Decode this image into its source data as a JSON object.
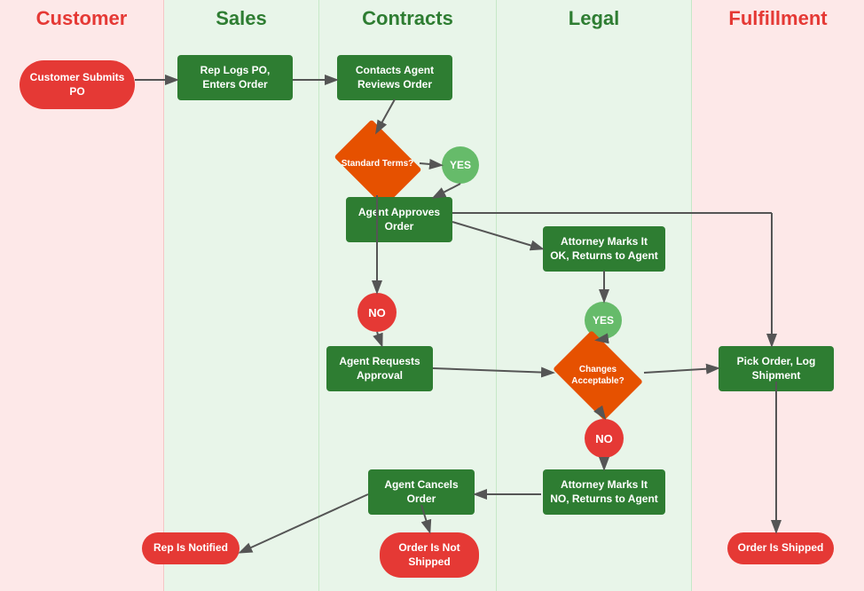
{
  "swimlanes": [
    {
      "id": "customer",
      "label": "Customer",
      "colorClass": "header-red",
      "bgClass": "swimlane-customer"
    },
    {
      "id": "sales",
      "label": "Sales",
      "colorClass": "header-green",
      "bgClass": "swimlane-sales"
    },
    {
      "id": "contracts",
      "label": "Contracts",
      "colorClass": "header-green",
      "bgClass": "swimlane-contracts"
    },
    {
      "id": "legal",
      "label": "Legal",
      "colorClass": "header-green",
      "bgClass": "swimlane-legal"
    },
    {
      "id": "fulfillment",
      "label": "Fulfillment",
      "colorClass": "header-red",
      "bgClass": "swimlane-fulfillment"
    }
  ],
  "nodes": {
    "customerSubmits": "Customer Submits PO",
    "repLogs": "Rep Logs PO, Enters Order",
    "contactsAgent": "Contacts Agent Reviews Order",
    "standardTerms": "Standard Terms?",
    "yes1": "YES",
    "agentApproves": "Agent Approves Order",
    "attorneyMarksOK": "Attorney Marks It OK, Returns to Agent",
    "changesAcceptable": "Changes Acceptable?",
    "yes2": "YES",
    "no1": "NO",
    "no2": "NO",
    "agentRequests": "Agent Requests Approval",
    "pickOrder": "Pick Order, Log Shipment",
    "attorneyMarksNo": "Attorney Marks It NO, Returns to Agent",
    "agentCancels": "Agent Cancels Order",
    "repNotified": "Rep Is Notified",
    "orderNotShipped": "Order Is Not Shipped",
    "orderShipped": "Order Is Shipped"
  }
}
